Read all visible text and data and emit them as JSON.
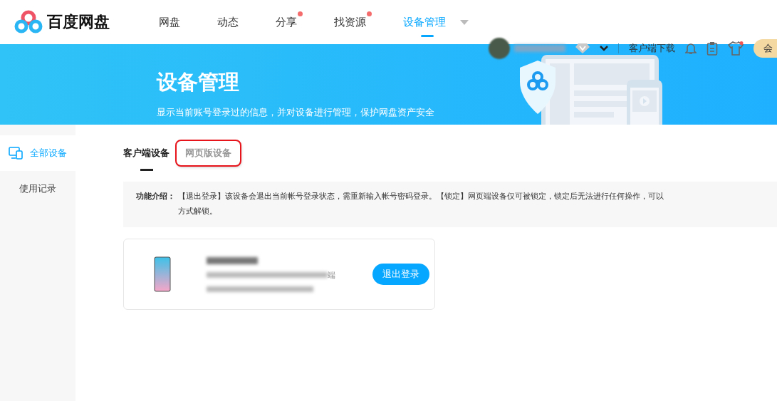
{
  "app": {
    "name": "百度网盘"
  },
  "nav": [
    {
      "label": "网盘",
      "selected": false,
      "dot": false
    },
    {
      "label": "动态",
      "selected": false,
      "dot": false
    },
    {
      "label": "分享",
      "selected": false,
      "dot": true
    },
    {
      "label": "找资源",
      "selected": false,
      "dot": true
    },
    {
      "label": "设备管理",
      "selected": true,
      "dot": false
    }
  ],
  "user_bar": {
    "download": "客户端下载",
    "member": "会"
  },
  "banner": {
    "title": "设备管理",
    "subtitle": "显示当前账号登录过的信息，并对设备进行管理，保护网盘资产安全"
  },
  "sidebar": [
    {
      "label": "全部设备",
      "selected": true
    },
    {
      "label": "使用记录",
      "selected": false
    }
  ],
  "tabs": [
    {
      "label": "客户端设备",
      "selected": true,
      "highlighted": false
    },
    {
      "label": "网页版设备",
      "selected": false,
      "highlighted": true
    }
  ],
  "notice": {
    "label": "功能介绍：",
    "lines": [
      "【退出登录】该设备会退出当前帐号登录状态，需重新输入帐号密码登录。【锁定】网页端设备仅可被锁定，锁定后无法进行任何操作，可以",
      "方式解锁。"
    ]
  },
  "devices": [
    {
      "detail_suffix": "端",
      "button": "退出登录"
    }
  ]
}
